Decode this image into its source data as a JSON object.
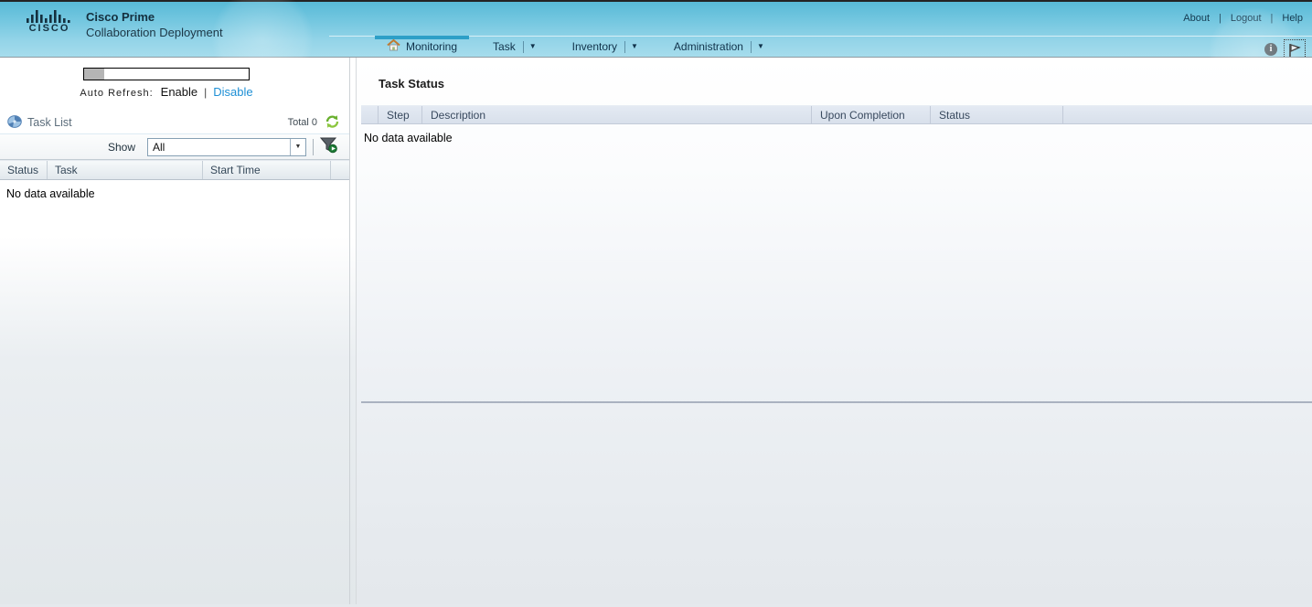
{
  "header": {
    "brand": {
      "logo_text": "CISCO",
      "product": "Cisco Prime",
      "subtitle": "Collaboration Deployment"
    },
    "links": {
      "about": "About",
      "logout": "Logout",
      "help": "Help",
      "separator": "|"
    },
    "nav": [
      {
        "label": "Monitoring",
        "selected": true,
        "icon": "home-icon",
        "has_dropdown": false
      },
      {
        "label": "Task",
        "selected": false,
        "has_dropdown": true
      },
      {
        "label": "Inventory",
        "selected": false,
        "has_dropdown": true
      },
      {
        "label": "Administration",
        "selected": false,
        "has_dropdown": true
      }
    ],
    "icons": {
      "info": "info-icon",
      "flag": "flag-icon",
      "info_glyph": "i"
    }
  },
  "sidebar": {
    "auto_refresh": {
      "label": "Auto Refresh:",
      "enable_label": "Enable",
      "disable_label": "Disable",
      "separator": "|",
      "progress_percent": 12
    },
    "task_list": {
      "title": "Task List",
      "total_label": "Total 0",
      "icons": {
        "list": "disk-icon",
        "refresh": "refresh-icon"
      }
    },
    "filter": {
      "show_label": "Show",
      "selected_value": "All",
      "icons": {
        "dropdown": "chevron-down-icon",
        "filter": "filter-run-icon"
      }
    },
    "table": {
      "columns": [
        "Status",
        "Task",
        "Start Time"
      ],
      "empty_text": "No data available"
    }
  },
  "main": {
    "title": "Task Status",
    "table": {
      "columns": [
        "Step",
        "Description",
        "Upon Completion",
        "Status"
      ],
      "empty_text": "No data available"
    }
  },
  "colors": {
    "accent_tab": "#2d9fc7",
    "link_blue": "#1e8fd5",
    "header_top": "#58bad7",
    "header_bottom": "#a6dcec",
    "table_header_bg": "#dce3ee",
    "divider": "#aab2c0"
  }
}
